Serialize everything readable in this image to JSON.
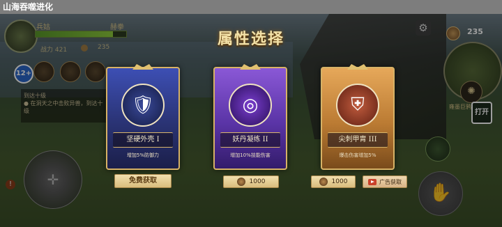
{
  "window": {
    "title": "山海吞噬进化"
  },
  "hud": {
    "player_name": "兵姑",
    "realm": "赫拳",
    "hp_fraction": 0.85,
    "power_label": "战力 421",
    "coins": "235",
    "age_rating": "12+",
    "quest_title": "到达十级",
    "quest_desc": "● 在洞天之中击败异兽，到达十级"
  },
  "top_right": {
    "coins": "235",
    "boss_name": "雍墨巨鸦",
    "open_label": "打开"
  },
  "modal": {
    "title": "属性选择",
    "cards": [
      {
        "name": "坚硬外壳 I",
        "desc": "增加5%防御力",
        "action": "免费获取"
      },
      {
        "name": "妖丹凝练 II",
        "desc": "增加10%技能伤害",
        "price": "1000"
      },
      {
        "name": "尖刺甲胄 III",
        "desc": "爆击伤害增加5%",
        "price": "1000",
        "ad_label": "广告获取"
      }
    ]
  },
  "colors": {
    "card_blue": "#3d4fb4",
    "card_purple": "#8a58d6",
    "card_gold": "#e6a85a",
    "frame_gold": "#d7b266"
  }
}
